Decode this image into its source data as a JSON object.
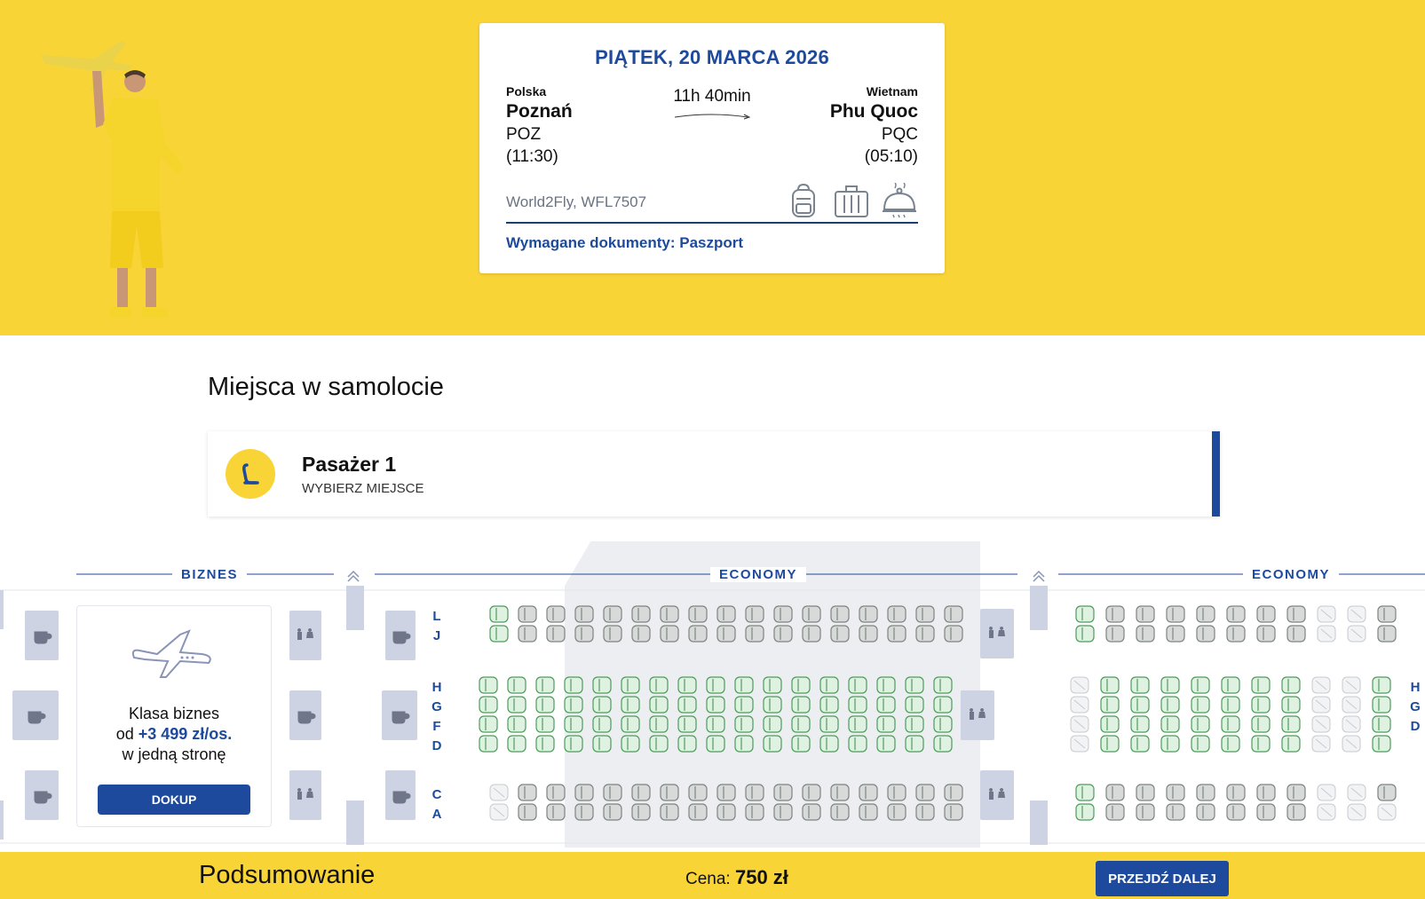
{
  "flight": {
    "date": "PIĄTEK, 20 MARCA 2026",
    "origin": {
      "country": "Polska",
      "city": "Poznań",
      "code": "POZ",
      "time": "(11:30)"
    },
    "destination": {
      "country": "Wietnam",
      "city": "Phu Quoc",
      "code": "PQC",
      "time": "(05:10)"
    },
    "duration": "11h 40min",
    "operator": "World2Fly, WFL7507",
    "documents": "Wymagane dokumenty: Paszport",
    "amenity_icons": [
      "backpack-icon",
      "suitcase-icon",
      "meal-icon"
    ]
  },
  "seats_section": {
    "title": "Miejsca w samolocie",
    "passenger": {
      "name": "Pasażer 1",
      "subtitle": "WYBIERZ MIEJSCE"
    }
  },
  "seatmap": {
    "sections": [
      "BIZNES",
      "ECONOMY",
      "ECONOMY"
    ],
    "row_letters_main": [
      "L",
      "J",
      "H",
      "G",
      "F",
      "D",
      "C",
      "A"
    ],
    "row_letters_right": [
      "H",
      "G",
      "D"
    ],
    "business_card": {
      "line1": "Klasa biznes",
      "price_prefix": "od ",
      "price": "+3 499 zł/os.",
      "line3": "w jedną stronę",
      "button": "DOKUP"
    }
  },
  "footer": {
    "summary": "Podsumowanie",
    "price_label": "Cena:",
    "price_value": "750 zł",
    "next_button": "PRZEJDŹ DALEJ"
  },
  "colors": {
    "brand_yellow": "#f9d437",
    "brand_blue": "#1d4a9c",
    "seat_green": "#dff2e1",
    "seat_grey": "#d7dad8",
    "facility": "#cdd3e2"
  }
}
